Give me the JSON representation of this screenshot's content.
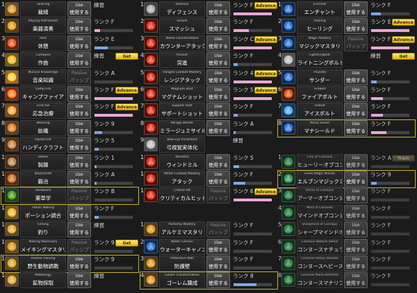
{
  "columns": [
    {
      "rows": [
        {
          "num": "1",
          "en": "Tailoring",
          "jp": "裁縫",
          "use_top": "Use",
          "use_bottom": "使用する",
          "rank": "練習",
          "bar": null,
          "icon": "needle-icon",
          "colors": [
            "#d9a441",
            "#7a4b12"
          ]
        },
        {
          "num": "2",
          "en": "Playing Instrument",
          "jp": "楽器演奏",
          "use_top": "Use",
          "use_bottom": "使用する",
          "rank": "ランク F",
          "bar": 0.15,
          "bar_color": "#e9a7d8",
          "icon": "lute-icon",
          "colors": [
            "#e0a630",
            "#5e3b10"
          ]
        },
        {
          "num": "3",
          "en": "Rest",
          "jp": "休憩",
          "use_top": "Use",
          "use_bottom": "使用する",
          "rank": "ランク E",
          "bar": 0.35,
          "bar_color": "#7fa7e8",
          "icon": "campfire-icon",
          "colors": [
            "#e2622a",
            "#6a1f0a"
          ]
        },
        {
          "num": "4",
          "en": "Compose",
          "jp": "作曲",
          "use_top": "Use",
          "use_bottom": "使用する",
          "rank": "練習",
          "bar": null,
          "btn": "Get",
          "icon": "quill-icon",
          "colors": [
            "#f1c232",
            "#7a5a10"
          ]
        },
        {
          "num": "5",
          "en": "Musical Knowledge",
          "jp": "音楽知識",
          "use_top": "Passive",
          "use_bottom": "パッシブ",
          "passive": true,
          "rank": "ランク A",
          "bar": 0.0,
          "bar_color": "#7fa7e8",
          "icon": "music-note-icon",
          "colors": [
            "#ffd23f",
            "#a0681a"
          ]
        },
        {
          "num": "6",
          "en": "Camp Fire",
          "jp": "キャンプファイア",
          "use_top": "Use",
          "use_bottom": "使用する",
          "rank": "ランク F",
          "bar": 1.0,
          "bar_color": "#e9a7d8",
          "btn": "Advance",
          "icon": "bonfire-icon",
          "colors": [
            "#ff8a2a",
            "#8a2a00"
          ]
        },
        {
          "num": "7",
          "en": "First Aid",
          "jp": "応急治療",
          "use_top": "Use",
          "use_bottom": "使用する",
          "rank": "ランク F",
          "bar": 1.0,
          "bar_color": "#e9a7d8",
          "btn": "Advance",
          "icon": "bandage-icon",
          "colors": [
            "#f0b04a",
            "#7a4a10"
          ]
        },
        {
          "num": "8",
          "en": "Weaving",
          "jp": "紡織",
          "use_top": "Use",
          "use_bottom": "使用する",
          "rank": "ランク 9",
          "bar": 0.2,
          "bar_color": "#7fa7e8",
          "icon": "spindle-icon",
          "colors": [
            "#d98a3a",
            "#6a3a10"
          ]
        },
        {
          "num": "9",
          "en": "Handicraft",
          "jp": "ハンディクラフト",
          "use_top": "Use",
          "use_bottom": "使用する",
          "rank": "ランク 5",
          "bar": 0.1,
          "bar_color": "#7fa7e8",
          "icon": "hammer-icon",
          "colors": [
            "#c98a4a",
            "#5a3010"
          ]
        },
        {
          "num": "10",
          "en": "Refine",
          "jp": "製錬",
          "use_top": "Use",
          "use_bottom": "使用する",
          "rank": "ランク 1",
          "bar": 0.05,
          "bar_color": "#7fa7e8",
          "icon": "ore-icon",
          "colors": [
            "#b98a5a",
            "#4a2a10"
          ]
        },
        {
          "num": "11",
          "en": "Blacksmith",
          "jp": "鍛冶",
          "use_top": "Use",
          "use_bottom": "使用する",
          "rank": "ランク A",
          "bar": 0.05,
          "bar_color": "#7fa7e8",
          "icon": "anvil-icon",
          "colors": [
            "#d07a30",
            "#5a2a08"
          ]
        },
        {
          "num": "12",
          "en": "Herbalism",
          "jp": "薬草学",
          "use_top": "Passive",
          "use_bottom": "パッシブ",
          "passive": true,
          "rank": "ランク B",
          "bar": 0.0,
          "bar_color": "#7fa7e8",
          "icon": "herb-icon",
          "colors": [
            "#5aa02a",
            "#1a4a0a"
          ],
          "selected": true
        },
        {
          "num": "13",
          "en": "Potion Making",
          "jp": "ポーション調合",
          "use_top": "Use",
          "use_bottom": "使用する",
          "rank": "ランク F",
          "bar": 0.1,
          "bar_color": "#7fa7e8",
          "icon": "potion-icon",
          "colors": [
            "#e8c040",
            "#7a5a10"
          ]
        },
        {
          "num": "14",
          "en": "Fishing",
          "jp": "釣り",
          "use_top": "Use",
          "use_bottom": "使用する",
          "rank": "練習",
          "bar": null,
          "icon": "fishing-rod-icon",
          "colors": [
            "#e0b050",
            "#6a4a10"
          ]
        },
        {
          "num": "15",
          "en": "Making Machinery",
          "jp": "メイキングマスタリ",
          "use_top": "Passive",
          "use_bottom": "パッシブ",
          "passive": true,
          "rank": "ランク 9",
          "bar": 0.0,
          "bar_color": "#7fa7e8",
          "btn": "Get",
          "icon": "gear-icon",
          "colors": [
            "#e0a030",
            "#6a4a10"
          ]
        },
        {
          "num": "16",
          "en": "Animal Training",
          "jp": "野生動物調教",
          "use_top": "Use",
          "use_bottom": "使用する",
          "rank": "ランク 9",
          "bar": 0.0,
          "bar_color": "#7fa7e8",
          "icon": "paw-icon",
          "colors": [
            "#d9b040",
            "#6a4a10"
          ],
          "selected": true
        },
        {
          "num": "17",
          "en": "Metallurgy",
          "jp": "鉱物採取",
          "use_top": "Use",
          "use_bottom": "使用する",
          "rank": "練習",
          "bar": null,
          "icon": "pickaxe-icon",
          "colors": [
            "#e0b050",
            "#6a4a10"
          ]
        }
      ]
    },
    {
      "rows": [
        {
          "num": "1",
          "en": "Defense",
          "jp": "ディフェンス",
          "use_top": "Use",
          "use_bottom": "使用する",
          "rank": "ランク F",
          "bar": 1.0,
          "bar_color": "#e9a7d8",
          "btn": "Advance",
          "icon": "shield-icon",
          "colors": [
            "#b0b0b0",
            "#404040"
          ]
        },
        {
          "num": "2",
          "en": "Smash",
          "jp": "スマッシュ",
          "use_top": "Use",
          "use_bottom": "使用する",
          "rank": "ランク F",
          "bar": 0.4,
          "bar_color": "#e9a7d8",
          "icon": "smash-icon",
          "colors": [
            "#e0402a",
            "#5a0a00"
          ]
        },
        {
          "num": "3",
          "en": "Melee Counterattack",
          "jp": "カウンターアタック",
          "use_top": "Use",
          "use_bottom": "使用する",
          "rank": "ランク C",
          "bar": 1.0,
          "bar_color": "#e9a7d8",
          "btn": "Advance",
          "icon": "counter-icon",
          "colors": [
            "#e0402a",
            "#5a0a00"
          ]
        },
        {
          "num": "4",
          "en": "Assault",
          "jp": "突進",
          "use_top": "Use",
          "use_bottom": "使用する",
          "rank": "ランク F",
          "bar": 0.1,
          "bar_color": "#7fa7e8",
          "icon": "charge-icon",
          "colors": [
            "#e0402a",
            "#5a0a00"
          ]
        },
        {
          "num": "5",
          "en": "Ranged Combat Mastery",
          "jp": "レンジアタック",
          "use_top": "Use",
          "use_bottom": "使用する",
          "rank": "ランク 4",
          "bar": 1.0,
          "bar_color": "#e9a7d8",
          "btn": "Advance",
          "icon": "bow-icon",
          "colors": [
            "#e0402a",
            "#5a0a00"
          ]
        },
        {
          "num": "6",
          "en": "Magnum Shot",
          "jp": "マグナムショット",
          "use_top": "Use",
          "use_bottom": "使用する",
          "rank": "ランク 5",
          "bar": 1.0,
          "bar_color": "#e9a7d8",
          "btn": "Advance",
          "icon": "arrow-icon",
          "colors": [
            "#e0402a",
            "#5a0a00"
          ]
        },
        {
          "num": "7",
          "en": "Support Shot",
          "jp": "サポートショット",
          "use_top": "Use",
          "use_bottom": "使用する",
          "rank": "ランク F",
          "bar": 0.1,
          "bar_color": "#7fa7e8",
          "icon": "support-arrow-icon",
          "colors": [
            "#e0402a",
            "#5a0a00"
          ]
        },
        {
          "num": "8",
          "en": "Mirage Missile",
          "jp": "ミラージュミサイル",
          "use_top": "Use",
          "use_bottom": "使用する",
          "rank": "ランク A",
          "bar": 0.05,
          "bar_color": "#7fa7e8",
          "icon": "missile-icon",
          "colors": [
            "#e0402a",
            "#5a0a00"
          ]
        },
        {
          "num": "9",
          "en": "Bow Eye Increment",
          "jp": "弓視覚実体化",
          "use_top": "",
          "use_bottom": "",
          "passive": true,
          "hide_use": true,
          "rank": "練習",
          "bar": null,
          "icon": "question-icon",
          "colors": [
            "#c0c0c0",
            "#505050"
          ]
        },
        {
          "num": "10",
          "en": "Windmill",
          "jp": "ウィンドミル",
          "use_top": "Use",
          "use_bottom": "使用する",
          "rank": "ランク 5",
          "bar": 0.15,
          "bar_color": "#7fa7e8",
          "icon": "windmill-icon",
          "colors": [
            "#e0402a",
            "#5a0a00"
          ]
        },
        {
          "num": "11",
          "en": "Melee Combat Mastery",
          "jp": "アタック",
          "use_top": "Use",
          "use_bottom": "使用する",
          "rank": "ランク F",
          "bar": 0.3,
          "bar_color": "#7fa7e8",
          "icon": "swords-icon",
          "colors": [
            "#e0402a",
            "#5a0a00"
          ]
        },
        {
          "num": "12",
          "en": "Critical Hit",
          "jp": "クリティカルヒット",
          "use_top": "Passive",
          "use_bottom": "パッシブ",
          "passive": true,
          "rank": "ランク 6",
          "bar": 1.0,
          "bar_color": "#e9a7d8",
          "btn": "Advance",
          "icon": "critical-icon",
          "colors": [
            "#e0402a",
            "#5a0a00"
          ]
        }
      ]
    },
    {
      "rows": [
        {
          "num": "1",
          "en": "Enchant",
          "jp": "エンチャント",
          "use_top": "Use",
          "use_bottom": "使用する",
          "rank": "ランク F",
          "bar": 0.25,
          "bar_color": "#7fa7e8",
          "icon": "enchant-icon",
          "colors": [
            "#3a7ad0",
            "#0a2a5a"
          ]
        },
        {
          "num": "2",
          "en": "Healing",
          "jp": "ヒーリング",
          "use_top": "Use",
          "use_bottom": "使用する",
          "rank": "ランク E",
          "bar": 1.0,
          "bar_color": "#e9a7d8",
          "btn": "Advance",
          "icon": "heal-icon",
          "colors": [
            "#3a7ad0",
            "#0a2a5a"
          ]
        },
        {
          "num": "3",
          "en": "Magic Mastery",
          "jp": "マジックマスタリ",
          "use_top": "Passive",
          "use_bottom": "パッシブ",
          "passive": true,
          "rank": "ランク F",
          "bar": 1.0,
          "bar_color": "#e9a7d8",
          "btn": "Advance",
          "icon": "magic-circle-icon",
          "colors": [
            "#3a7ad0",
            "#0a2a5a"
          ]
        },
        {
          "num": "4",
          "en": "Lightningbolt",
          "jp": "ライトニングボルト",
          "use_top": "",
          "use_bottom": "",
          "hide_use": true,
          "rank": "練習",
          "bar": null,
          "btn": "Get",
          "icon": "question-icon",
          "colors": [
            "#c0c0c0",
            "#505050"
          ]
        },
        {
          "num": "5",
          "en": "Thunder",
          "jp": "サンダー",
          "use_top": "Use",
          "use_bottom": "使用する",
          "rank": "ランク F",
          "bar": 0.15,
          "bar_color": "#7fa7e8",
          "icon": "thunder-icon",
          "colors": [
            "#3a7ad0",
            "#0a2a5a"
          ]
        },
        {
          "num": "6",
          "en": "Firebolt",
          "jp": "ファイアボルト",
          "use_top": "Use",
          "use_bottom": "使用する",
          "rank": "ランク F",
          "bar": 0.3,
          "bar_color": "#e9a7d8",
          "icon": "fire-icon",
          "colors": [
            "#e06020",
            "#5a1a00"
          ]
        },
        {
          "num": "7",
          "en": "Icebolt",
          "jp": "アイスボルト",
          "use_top": "Use",
          "use_bottom": "使用する",
          "rank": "ランク F",
          "bar": 0.3,
          "bar_color": "#e9a7d8",
          "icon": "ice-icon",
          "colors": [
            "#5ab0e8",
            "#0a3a6a"
          ]
        },
        {
          "num": "8",
          "en": "Mana Shield",
          "jp": "マナシールド",
          "use_top": "Use",
          "use_bottom": "使用する",
          "rank": "ランク F",
          "bar": 0.4,
          "bar_color": "#e9a7d8",
          "icon": "mana-shield-icon",
          "colors": [
            "#3a7ad0",
            "#0a2a5a"
          ],
          "selected": true
        },
        {
          "gap": true
        },
        {
          "num": "1",
          "en": "Fury of Connous",
          "jp": "ヒューリーオブコンヌース",
          "use_top": "Use",
          "use_bottom": "使用する",
          "rank": "ランク A",
          "bar": 0.0,
          "bar_color": "#7fa7e8",
          "btn": "Train",
          "icon": "fury-icon",
          "colors": [
            "#3a9a5a",
            "#0a3a1a"
          ],
          "dim": true
        },
        {
          "num": "2",
          "en": "Elven Magic Missile",
          "jp": "エルブンマジックミサイル",
          "use_top": "Use",
          "use_bottom": "使用する",
          "rank": "ランク 9",
          "bar": 0.15,
          "bar_color": "#7fa7e8",
          "icon": "elven-missile-icon",
          "colors": [
            "#3a9a5a",
            "#0a3a1a"
          ],
          "selected": true
        },
        {
          "num": "3",
          "en": "Armor of Connous",
          "jp": "アーマーオブコンヌース",
          "use_top": "Use",
          "use_bottom": "使用する",
          "rank": "ランク F",
          "bar": 0.0,
          "bar_color": "#7fa7e8",
          "icon": "armor-icon",
          "colors": [
            "#3a9a5a",
            "#0a3a1a"
          ],
          "dim": true
        },
        {
          "num": "4",
          "en": "Mind of Connous",
          "jp": "マインドオブコンヌース",
          "use_top": "Use",
          "use_bottom": "使用する",
          "rank": "ランク F",
          "bar": 0.0,
          "bar_color": "#7fa7e8",
          "icon": "mind-icon",
          "colors": [
            "#3a9a5a",
            "#0a3a1a"
          ],
          "dim": true
        },
        {
          "num": "5",
          "en": "Sharpmind of Connous",
          "jp": "シャープマインドオブコンヌース",
          "use_top": "Use",
          "use_bottom": "使用する",
          "rank": "ランク F",
          "bar": 0.0,
          "bar_color": "#7fa7e8",
          "icon": "sharpmind-icon",
          "colors": [
            "#3a9a5a",
            "#0a3a1a"
          ],
          "dim": true
        },
        {
          "num": "6",
          "en": "Connous Natural Shield",
          "jp": "コンヌースナチュラルシールド",
          "use_top": "Use",
          "use_bottom": "使用する",
          "rank": "ランク F",
          "bar": 0.0,
          "bar_color": "#7fa7e8",
          "icon": "natural-shield-icon",
          "colors": [
            "#3a9a5a",
            "#0a3a1a"
          ],
          "dim": true
        },
        {
          "num": "7",
          "en": "Connous Heavy Stander",
          "jp": "コンヌースヘビースタンダード",
          "use_top": "Use",
          "use_bottom": "使用する",
          "rank": "ランク F",
          "bar": 0.0,
          "bar_color": "#7fa7e8",
          "icon": "heavy-stander-icon",
          "colors": [
            "#3a9a5a",
            "#0a3a1a"
          ],
          "dim": true
        },
        {
          "num": "8",
          "en": "Connous Mana Reflector",
          "jp": "コンヌースマナリフレクター",
          "use_top": "Use",
          "use_bottom": "使用する",
          "rank": "ランク F",
          "bar": 0.0,
          "bar_color": "#7fa7e8",
          "icon": "mana-reflector-icon",
          "colors": [
            "#3a9a5a",
            "#0a3a1a"
          ],
          "dim": true
        }
      ]
    },
    {
      "rows": [
        {
          "gap": true
        },
        {
          "gap": true
        },
        {
          "gap": true
        },
        {
          "gap": true
        },
        {
          "gap": true
        },
        {
          "gap": true
        },
        {
          "gap": true
        },
        {
          "gap": true
        },
        {
          "gap": true
        },
        {
          "gap": true
        },
        {
          "gap": true
        },
        {
          "gap": true
        },
        {
          "gap": true
        },
        {
          "num": "1",
          "en": "Alchemy Mastery",
          "jp": "アルケミマスタリ",
          "use_top": "Passive",
          "use_bottom": "パッシブ",
          "passive": true,
          "rank": "ランク F",
          "bar": 0.0,
          "bar_color": "#7fa7e8",
          "icon": "alchemy-icon",
          "colors": [
            "#e0a030",
            "#5a3a10"
          ]
        },
        {
          "num": "2",
          "en": "Water Cannon",
          "jp": "ウォーターキャノン",
          "use_top": "Use",
          "use_bottom": "使用する",
          "rank": "ランク F",
          "bar": 0.0,
          "bar_color": "#7fa7e8",
          "icon": "water-cannon-icon",
          "colors": [
            "#3a7ad0",
            "#0a2a5a"
          ]
        },
        {
          "num": "3",
          "en": "Protective Wall",
          "jp": "防護壁",
          "use_top": "Use",
          "use_bottom": "使用する",
          "rank": "ランク F",
          "bar": 0.0,
          "bar_color": "#7fa7e8",
          "icon": "wall-icon",
          "colors": [
            "#e0a030",
            "#5a3a10"
          ]
        },
        {
          "num": "4",
          "en": "Golem Transformation",
          "jp": "ゴーレム錬成",
          "use_top": "Use",
          "use_bottom": "使用する",
          "rank": "ランク 8",
          "bar": 0.6,
          "bar_color": "#7fa7e8",
          "icon": "golem-icon",
          "colors": [
            "#e0a030",
            "#5a3a10"
          ],
          "selected": true
        }
      ]
    }
  ]
}
